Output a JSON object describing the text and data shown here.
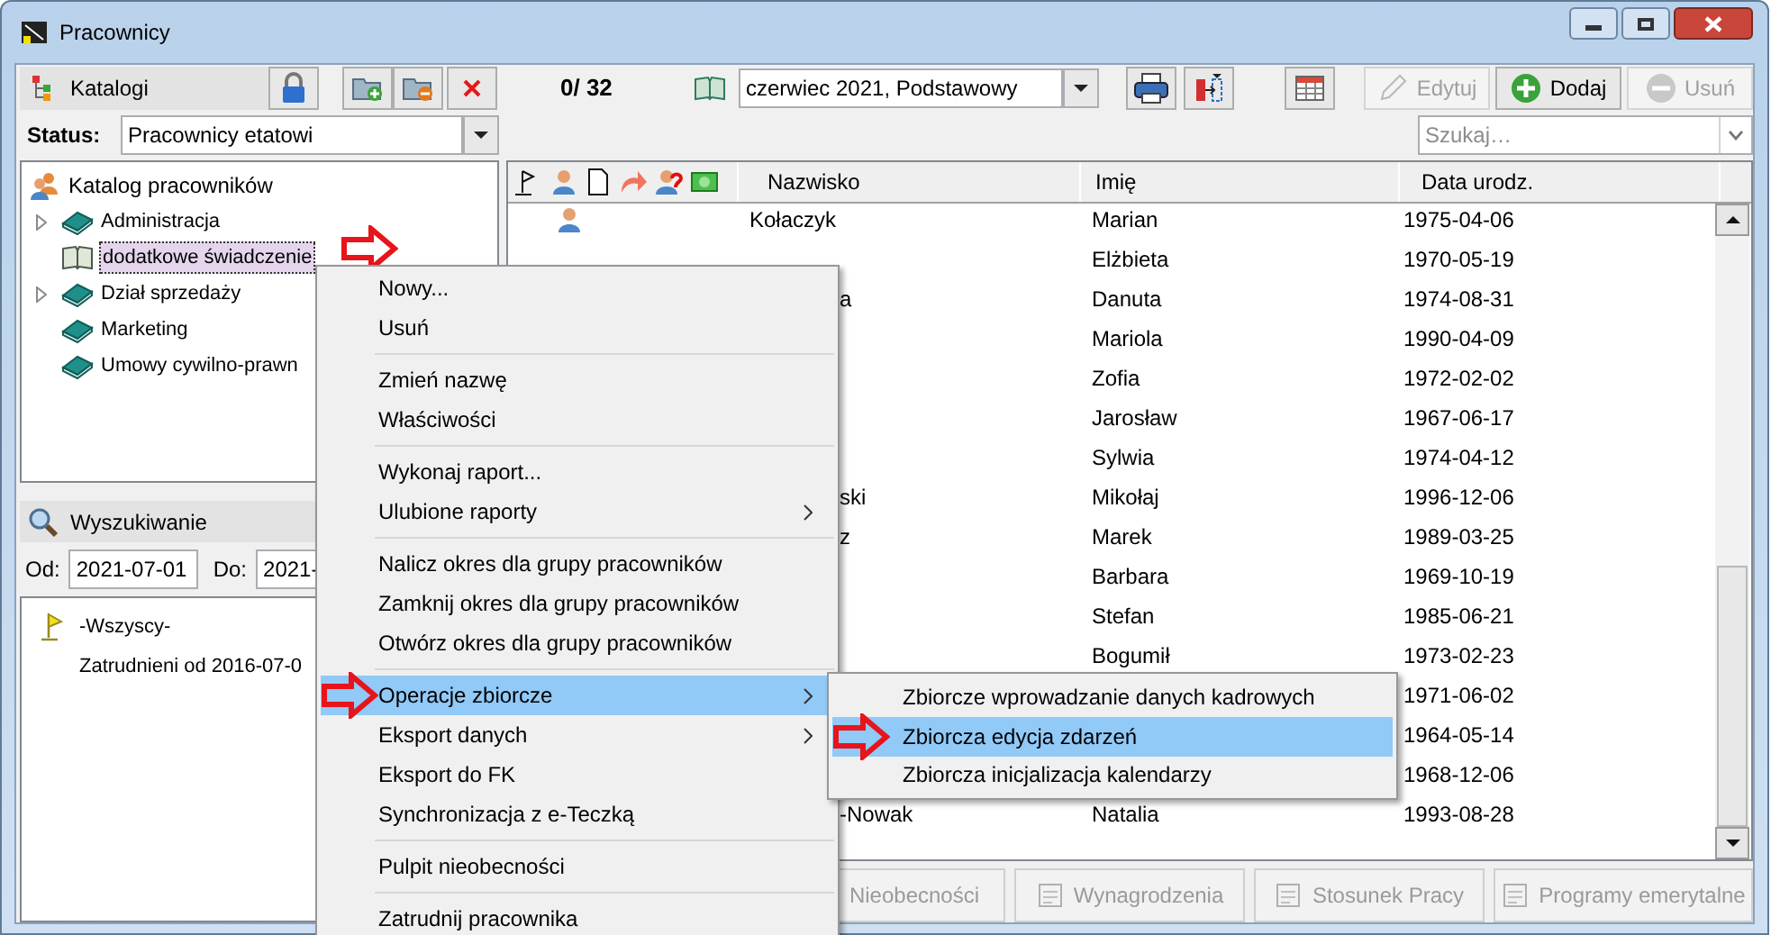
{
  "window": {
    "title": "Pracownicy"
  },
  "catalog_panel": {
    "title": "Katalogi",
    "status_label": "Status:",
    "status_value": "Pracownicy etatowi"
  },
  "tree": {
    "label": "Katalog pracowników",
    "children": [
      {
        "label": "Administracja",
        "expandable": true,
        "selected": false
      },
      {
        "label": "dodatkowe świadczenie",
        "expandable": false,
        "selected": true,
        "marked": true
      },
      {
        "label": "Dział sprzedaży",
        "expandable": true,
        "selected": false
      },
      {
        "label": "Marketing",
        "expandable": false,
        "selected": false
      },
      {
        "label": "Umowy cywilno-prawn",
        "expandable": false,
        "selected": false
      }
    ]
  },
  "search_panel": {
    "title": "Wyszukiwanie",
    "from_label": "Od:",
    "from_value": "2021-07-01",
    "to_label": "Do:",
    "to_value": "2021-",
    "items": [
      {
        "label": "-Wszyscy-",
        "kind": "flag"
      },
      {
        "label": "Zatrudnieni od 2016-07-0",
        "kind": "plain"
      }
    ]
  },
  "toolbar": {
    "count": "0/ 32",
    "period": "czerwiec 2021, Podstawowy",
    "search_placeholder": "Szukaj…",
    "buttons": [
      {
        "label": "Edytuj",
        "disabled": true
      },
      {
        "label": "Dodaj",
        "disabled": false
      },
      {
        "label": "Usuń",
        "disabled": true
      }
    ]
  },
  "table": {
    "columns": [
      "Nazwisko",
      "Imię",
      "Data urodz."
    ],
    "rows": [
      {
        "person_icon": true,
        "name": "Kołaczyk",
        "name_cut": false,
        "first": "Marian",
        "born": "1975-04-06"
      },
      {
        "first": "Elżbieta",
        "born": "1970-05-19"
      },
      {
        "name": "a",
        "name_cut": true,
        "first": "Danuta",
        "born": "1974-08-31"
      },
      {
        "first": "Mariola",
        "born": "1990-04-09"
      },
      {
        "first": "Zofia",
        "born": "1972-02-02"
      },
      {
        "first": "Jarosław",
        "born": "1967-06-17"
      },
      {
        "first": "Sylwia",
        "born": "1974-04-12"
      },
      {
        "name": "ski",
        "name_cut": true,
        "first": "Mikołaj",
        "born": "1996-12-06"
      },
      {
        "name": "z",
        "name_cut": true,
        "first": "Marek",
        "born": "1989-03-25"
      },
      {
        "first": "Barbara",
        "born": "1969-10-19"
      },
      {
        "first": "Stefan",
        "born": "1985-06-21"
      },
      {
        "first": "Bogumił",
        "born": "1973-02-23"
      },
      {
        "born": "1971-06-02"
      },
      {
        "born": "1964-05-14"
      },
      {
        "born": "1968-12-06"
      },
      {
        "name": "-Nowak",
        "name_cut": true,
        "first": "Natalia",
        "born": "1993-08-28"
      }
    ]
  },
  "bottom_buttons": [
    {
      "label": "Nieobecności",
      "disabled": true
    },
    {
      "label": "Wynagrodzenia",
      "disabled": true
    },
    {
      "label": "Stosunek Pracy",
      "disabled": true
    },
    {
      "label": "Programy emerytalne",
      "disabled": true
    }
  ],
  "context_menu": {
    "groups": [
      [
        {
          "label": "Nowy...",
          "submenu": false,
          "selected": false,
          "marked": false
        },
        {
          "label": "Usuń",
          "submenu": false,
          "selected": false,
          "marked": false
        }
      ],
      [
        {
          "label": "Zmień nazwę",
          "submenu": false,
          "selected": false,
          "marked": false
        },
        {
          "label": "Właściwości",
          "submenu": false,
          "selected": false,
          "marked": false
        }
      ],
      [
        {
          "label": "Wykonaj raport...",
          "submenu": false,
          "selected": false,
          "marked": false
        },
        {
          "label": "Ulubione raporty",
          "submenu": true,
          "selected": false,
          "marked": false
        }
      ],
      [
        {
          "label": "Nalicz okres dla grupy pracowników",
          "submenu": false,
          "selected": false,
          "marked": false
        },
        {
          "label": "Zamknij okres dla grupy pracowników",
          "submenu": false,
          "selected": false,
          "marked": false
        },
        {
          "label": "Otwórz okres dla grupy pracowników",
          "submenu": false,
          "selected": false,
          "marked": false
        }
      ],
      [
        {
          "label": "Operacje zbiorcze",
          "submenu": true,
          "selected": true,
          "marked": true
        },
        {
          "label": "Eksport danych",
          "submenu": true,
          "selected": false,
          "marked": false
        },
        {
          "label": "Eksport do FK",
          "submenu": false,
          "selected": false,
          "marked": false
        },
        {
          "label": "Synchronizacja z e-Teczką",
          "submenu": false,
          "selected": false,
          "marked": false
        }
      ],
      [
        {
          "label": "Pulpit nieobecności",
          "submenu": false,
          "selected": false,
          "marked": false
        }
      ],
      [
        {
          "label": "Zatrudnij pracownika",
          "submenu": false,
          "selected": false,
          "marked": false
        }
      ]
    ]
  },
  "submenu": {
    "items": [
      {
        "label": "Zbiorcze wprowadzanie danych kadrowych",
        "selected": false,
        "marked": false
      },
      {
        "label": "Zbiorcza edycja zdarzeń",
        "selected": true,
        "marked": true
      },
      {
        "label": "Zbiorcza inicjalizacja kalendarzy",
        "selected": false,
        "marked": false
      }
    ]
  }
}
